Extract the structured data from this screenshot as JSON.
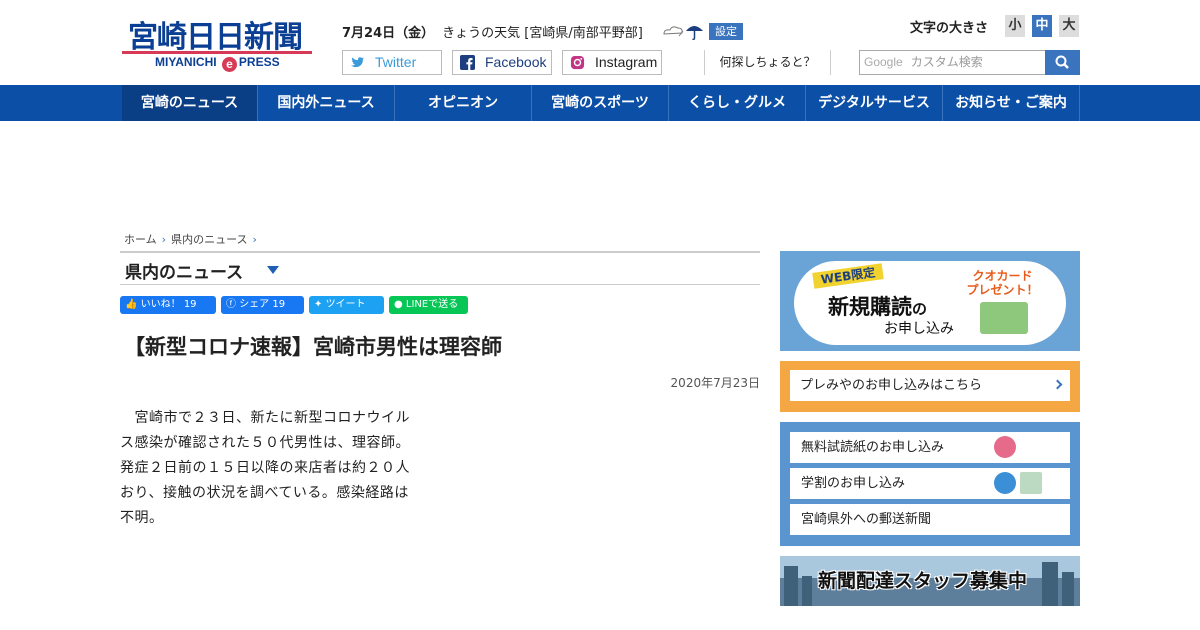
{
  "logo": {
    "main": "宮崎日日新聞",
    "sub_left": "MIYANICHI",
    "sub_e": "e",
    "sub_right": "PRESS"
  },
  "header": {
    "date": "7月24日（金）",
    "weather_text": "きょうの天気 [宮崎県/南部平野部]",
    "settings_label": "設定",
    "fontsize_label": "文字の大きさ",
    "fontsize_small": "小",
    "fontsize_medium": "中",
    "fontsize_large": "大",
    "twitter_label": "Twitter",
    "facebook_label": "Facebook",
    "instagram_label": "Instagram",
    "search_hint": "何探しちょると？",
    "search_brand": "Google",
    "search_placeholder": "カスタム検索"
  },
  "nav": [
    {
      "label": "宮崎のニュース"
    },
    {
      "label": "国内外ニュース"
    },
    {
      "label": "オピニオン"
    },
    {
      "label": "宮崎のスポーツ"
    },
    {
      "label": "くらし・グルメ"
    },
    {
      "label": "デジタルサービス"
    },
    {
      "label": "お知らせ・ご案内"
    }
  ],
  "breadcrumb": {
    "home": "ホーム",
    "section": "県内のニュース"
  },
  "section_title": "県内のニュース",
  "share": {
    "like": "いいね！ 19",
    "facebook": "シェア 19",
    "tweet": "ツイート",
    "line": "LINEで送る"
  },
  "article": {
    "title": "【新型コロナ速報】宮崎市男性は理容師",
    "date": "2020年7月23日",
    "lines": [
      "宮崎市で２３日、新たに新型コロナウイル",
      "ス感染が確認された５０代男性は、理容師。",
      "発症２日前の１５日以降の来店者は約２０人",
      "おり、接触の状況を調べている。感染経路は",
      "不明。"
    ]
  },
  "sidebar": {
    "promo_tag": "WEB限定",
    "promo_big": "新規購読",
    "promo_no": "の",
    "promo_small": "お申し込み",
    "quo_line1": "クオカード",
    "quo_line2": "プレゼント！",
    "premium": "プレみやのお申し込みはこちら",
    "links": [
      "無料試読紙のお申し込み",
      "学割のお申し込み",
      "宮崎県外への郵送新聞"
    ],
    "staff": "新聞配達スタッフ募集中"
  },
  "colors": {
    "brand_blue": "#0b4fa6",
    "accent_red": "#d63a57",
    "orange": "#f4a742"
  }
}
